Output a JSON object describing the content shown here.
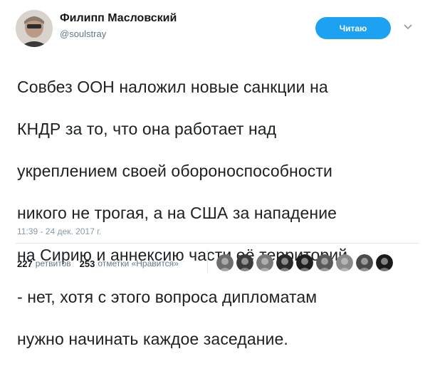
{
  "author": {
    "name": "Филипп Масловский",
    "handle": "@soulstray"
  },
  "follow_button": {
    "label": "Читаю"
  },
  "tweet": {
    "lines": [
      "Совбез ООН наложил новые санкции на",
      "КНДР за то, что она работает над",
      "укреплением своей обороноспособности",
      "никого не трогая, а на США за нападение",
      "на Сирию и аннексию части её территорий",
      "- нет, хотя с этого вопроса дипломатам",
      "нужно начинать каждое заседание."
    ],
    "timestamp": "11:39 - 24 дек. 2017 г."
  },
  "stats": {
    "retweets_count": "227",
    "retweets_label": "ретвитов",
    "likes_count": "253",
    "likes_label": "отметки «Нравится»"
  },
  "likers": [
    {
      "icon": "liker-avatar-1",
      "color": "#6d6d6d"
    },
    {
      "icon": "liker-avatar-2",
      "color": "#3b3b3b"
    },
    {
      "icon": "liker-avatar-3",
      "color": "#7a7a7a"
    },
    {
      "icon": "liker-avatar-4",
      "color": "#2a2a2a"
    },
    {
      "icon": "liker-avatar-5",
      "color": "#1f1f1f"
    },
    {
      "icon": "liker-avatar-6",
      "color": "#5a5a5a"
    },
    {
      "icon": "liker-avatar-7",
      "color": "#8a8a8a"
    },
    {
      "icon": "liker-avatar-8",
      "color": "#4a4a4a"
    },
    {
      "icon": "liker-avatar-9",
      "color": "#1a1a1a"
    }
  ],
  "colors": {
    "accent": "#1da1f2",
    "text": "#1c2022",
    "muted": "#657786",
    "divider": "#e1e8ed"
  }
}
